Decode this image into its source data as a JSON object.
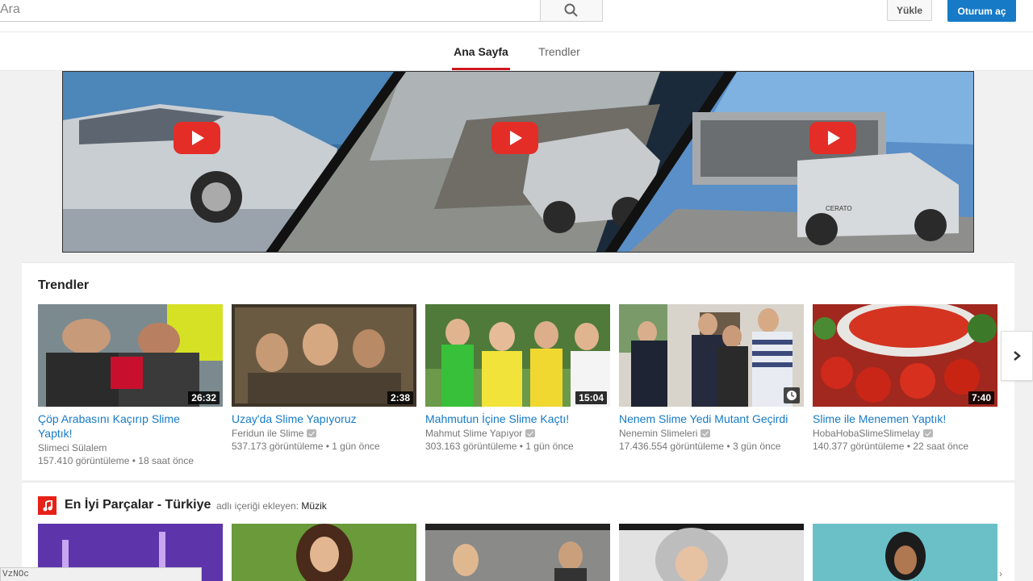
{
  "header": {
    "search_placeholder": "Ara",
    "upload_label": "Yükle",
    "signin_label": "Oturum aç"
  },
  "nav": {
    "tabs": [
      {
        "label": "Ana Sayfa",
        "active": true
      },
      {
        "label": "Trendler",
        "active": false
      }
    ]
  },
  "banner": {
    "car_badge": "CERATO"
  },
  "trending": {
    "title": "Trendler",
    "videos": [
      {
        "title_line1": "Çöp Arabasını Kaçırıp Slime",
        "title_line2": "Yaptık!",
        "channel": "Slimeci Sülalem",
        "verified": false,
        "views": "157.410 görüntüleme",
        "age": "18 saat önce",
        "duration": "26:32"
      },
      {
        "title_line1": "Uzay'da Slime Yapıyoruz",
        "title_line2": "",
        "channel": "Feridun ile Slime",
        "verified": true,
        "views": "537.173 görüntüleme",
        "age": "1 gün önce",
        "duration": "2:38"
      },
      {
        "title_line1": "Mahmutun İçine Slime Kaçtı!",
        "title_line2": "",
        "channel": "Mahmut Slime Yapıyor",
        "verified": true,
        "views": "303.163 görüntüleme",
        "age": "1 gün önce",
        "duration": "15:04"
      },
      {
        "title_line1": "Nenem Slime Yedi Mutant Geçirdi",
        "title_line2": "",
        "channel": "Nenemin Slimeleri",
        "verified": true,
        "views": "17.436.554 görüntüleme",
        "age": "3 gün önce",
        "duration": ""
      },
      {
        "title_line1": "Slime ile Menemen Yaptık!",
        "title_line2": "",
        "channel": "HobaHobaSlimeSlimelay",
        "verified": true,
        "views": "140.377 görüntüleme",
        "age": "22 saat önce",
        "duration": "7:40"
      }
    ]
  },
  "music_shelf": {
    "title": "En İyi Parçalar - Türkiye",
    "attribution_prefix": "adlı içeriği ekleyen:",
    "attribution_name": "Müzik"
  },
  "status_bar": {
    "url": "VzNOc"
  },
  "colors": {
    "link_blue": "#167ac6",
    "brand_red": "#cc181e",
    "play_red": "#e52d27"
  }
}
